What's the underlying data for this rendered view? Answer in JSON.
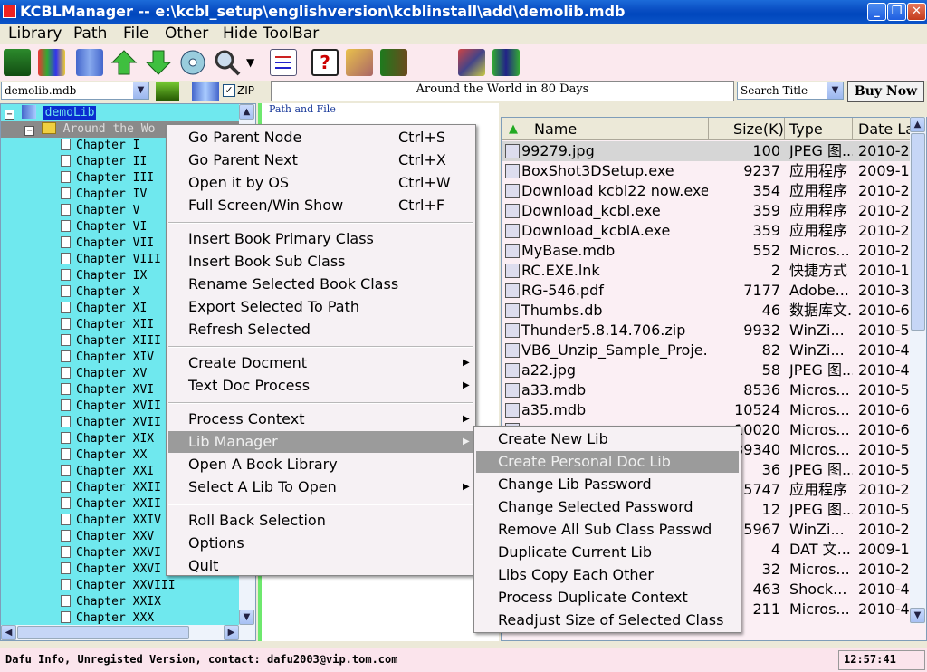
{
  "window": {
    "title": "KCBLManager -- e:\\kcbl_setup\\englishversion\\kcblinstall\\add\\demolib.mdb"
  },
  "menubar": {
    "items": [
      "Library",
      "Path",
      "File",
      "Other",
      "Hide ToolBar"
    ]
  },
  "toolbar": {
    "icons": [
      "library-books-icon",
      "add-books-icon",
      "bookshelf-icon",
      "up-arrow-icon",
      "down-arrow-icon",
      "disc-icon",
      "search-magnifier-icon",
      "dropdown-arrow-icon",
      "checklist-icon",
      "help-icon",
      "keys-icon",
      "exit-door-icon",
      "tools-icon",
      "chart-icon"
    ]
  },
  "combos": {
    "library": "demolib.mdb",
    "zip_label": "ZIP",
    "zip_checked": true,
    "current_book": "Around the World in 80 Days",
    "search_mode": "Search Title",
    "buy_now": "Buy Now"
  },
  "tree": {
    "root": "demoLib",
    "book": "Around the Wo",
    "chapters": [
      "Chapter I",
      "Chapter II",
      "Chapter III",
      "Chapter IV",
      "Chapter V",
      "Chapter VI",
      "Chapter VII",
      "Chapter VIII",
      "Chapter IX",
      "Chapter X",
      "Chapter XI",
      "Chapter XII",
      "Chapter XIII",
      "Chapter XIV",
      "Chapter XV",
      "Chapter XVI",
      "Chapter XVII",
      "Chapter XVII",
      "Chapter XIX",
      "Chapter XX",
      "Chapter XXI",
      "Chapter XXII",
      "Chapter XXII",
      "Chapter XXIV",
      "Chapter XXV",
      "Chapter XXVI",
      "Chapter XXVI",
      "Chapter XXVIII",
      "Chapter XXIX",
      "Chapter XXX"
    ]
  },
  "midpanel": {
    "label": "Path and File"
  },
  "filelist": {
    "headers": {
      "name": "Name",
      "size": "Size(K)",
      "type": "Type",
      "date": "Date La"
    },
    "rows": [
      {
        "name": "99279.jpg",
        "size": "100",
        "type": "JPEG 图...",
        "date": "2010-2-"
      },
      {
        "name": "BoxShot3DSetup.exe",
        "size": "9237",
        "type": "应用程序",
        "date": "2009-12"
      },
      {
        "name": "Download kcbl22 now.exe",
        "size": "354",
        "type": "应用程序",
        "date": "2010-2-"
      },
      {
        "name": "Download_kcbl.exe",
        "size": "359",
        "type": "应用程序",
        "date": "2010-2-"
      },
      {
        "name": "Download_kcblA.exe",
        "size": "359",
        "type": "应用程序",
        "date": "2010-2-"
      },
      {
        "name": "MyBase.mdb",
        "size": "552",
        "type": "Micros...",
        "date": "2010-2-"
      },
      {
        "name": "RC.EXE.lnk",
        "size": "2",
        "type": "快捷方式",
        "date": "2010-1-"
      },
      {
        "name": "RG-546.pdf",
        "size": "7177",
        "type": "Adobe...",
        "date": "2010-3-"
      },
      {
        "name": "Thumbs.db",
        "size": "46",
        "type": "数据库文...",
        "date": "2010-6-"
      },
      {
        "name": "Thunder5.8.14.706.zip",
        "size": "9932",
        "type": "WinZi...",
        "date": "2010-5-"
      },
      {
        "name": "VB6_Unzip_Sample_Proje...",
        "size": "82",
        "type": "WinZi...",
        "date": "2010-4-"
      },
      {
        "name": "a22.jpg",
        "size": "58",
        "type": "JPEG 图...",
        "date": "2010-4-"
      },
      {
        "name": "a33.mdb",
        "size": "8536",
        "type": "Micros...",
        "date": "2010-5-"
      },
      {
        "name": "a35.mdb",
        "size": "10524",
        "type": "Micros...",
        "date": "2010-6-"
      },
      {
        "name": "",
        "size": "10020",
        "type": "Micros...",
        "date": "2010-6-"
      },
      {
        "name": "",
        "size": "39340",
        "type": "Micros...",
        "date": "2010-5-"
      },
      {
        "name": "",
        "size": "36",
        "type": "JPEG 图...",
        "date": "2010-5-"
      },
      {
        "name": "",
        "size": "5747",
        "type": "应用程序",
        "date": "2010-2-"
      },
      {
        "name": "",
        "size": "12",
        "type": "JPEG 图...",
        "date": "2010-5-"
      },
      {
        "name": "",
        "size": "5967",
        "type": "WinZi...",
        "date": "2010-2-"
      },
      {
        "name": "",
        "size": "4",
        "type": "DAT 文...",
        "date": "2009-12"
      },
      {
        "name": "",
        "size": "32",
        "type": "Micros...",
        "date": "2010-2-"
      },
      {
        "name": "",
        "size": "463",
        "type": "Shock...",
        "date": "2010-4-"
      },
      {
        "name": "",
        "size": "211",
        "type": "Micros...",
        "date": "2010-4-"
      }
    ]
  },
  "context_menu": {
    "groups": [
      [
        {
          "label": "Go Parent Node",
          "shortcut": "Ctrl+S"
        },
        {
          "label": "Go Parent Next",
          "shortcut": "Ctrl+X"
        },
        {
          "label": "Open it by OS",
          "shortcut": "Ctrl+W"
        },
        {
          "label": "Full Screen/Win Show",
          "shortcut": "Ctrl+F"
        }
      ],
      [
        {
          "label": "Insert Book Primary Class"
        },
        {
          "label": "Insert Book Sub Class"
        },
        {
          "label": "Rename Selected Book Class"
        },
        {
          "label": "Export Selected To Path"
        },
        {
          "label": "Refresh Selected"
        }
      ],
      [
        {
          "label": "Create Docment",
          "submenu": true
        },
        {
          "label": "Text Doc Process",
          "submenu": true
        }
      ],
      [
        {
          "label": "Process Context",
          "submenu": true
        },
        {
          "label": "Lib Manager",
          "submenu": true,
          "selected": true
        },
        {
          "label": "Open A Book Library"
        },
        {
          "label": "Select A Lib To Open",
          "submenu": true
        }
      ],
      [
        {
          "label": "Roll Back Selection"
        },
        {
          "label": "Options"
        },
        {
          "label": "Quit"
        }
      ]
    ]
  },
  "lib_submenu": {
    "items": [
      {
        "label": "Create New Lib"
      },
      {
        "label": "Create Personal Doc Lib",
        "selected": true
      },
      {
        "label": "Change Lib Password"
      },
      {
        "label": "Change Selected Password"
      },
      {
        "label": "Remove All Sub Class Passwd"
      },
      {
        "label": "Duplicate Current Lib"
      },
      {
        "label": "Libs Copy Each Other"
      },
      {
        "label": "Process Duplicate Context"
      },
      {
        "label": "Readjust Size of Selected Class"
      }
    ]
  },
  "status": {
    "info": "Dafu Info, Unregisted Version, contact: dafu2003@vip.tom.com",
    "time": "12:57:41"
  },
  "colors": {
    "titlebar": "#0a4fc4",
    "tree_bg": "#6fe8ee",
    "selected_menu": "#9b9b9b",
    "green_border": "#6ee86e"
  }
}
